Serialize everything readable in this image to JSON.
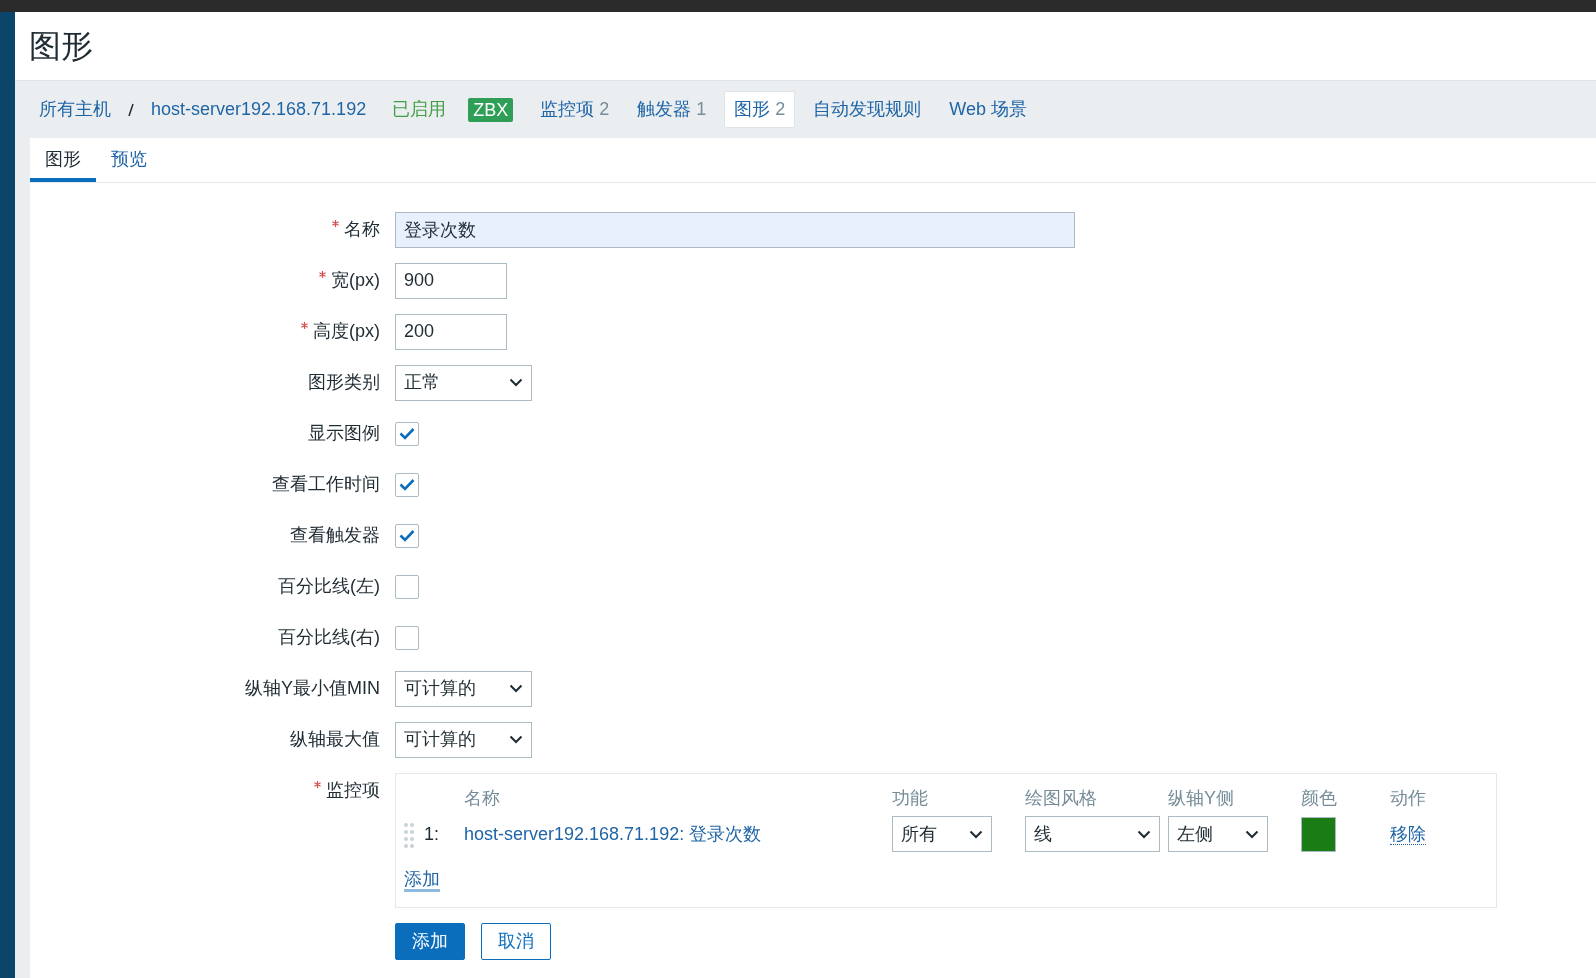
{
  "title": "图形",
  "breadcrumb": [
    {
      "text": "所有主机"
    },
    {
      "text": "host-server192.168.71.192"
    }
  ],
  "host_status": "已启用",
  "badge": "ZBX",
  "host_tabs": [
    {
      "label": "监控项",
      "count": "2",
      "selected": false
    },
    {
      "label": "触发器",
      "count": "1",
      "selected": false
    },
    {
      "label": "图形",
      "count": "2",
      "selected": true
    },
    {
      "label": "自动发现规则",
      "selected": false
    },
    {
      "label": "Web 场景",
      "selected": false
    }
  ],
  "tabs": [
    {
      "label": "图形",
      "selected": true
    },
    {
      "label": "预览",
      "selected": false
    }
  ],
  "fields": [
    {
      "kind": "text",
      "label": "名称",
      "required": true,
      "value": "登录次数",
      "wide": true,
      "focused": true
    },
    {
      "kind": "text",
      "label": "宽(px)",
      "required": true,
      "value": "900"
    },
    {
      "kind": "text",
      "label": "高度(px)",
      "required": true,
      "value": "200"
    },
    {
      "kind": "select",
      "label": "图形类别",
      "value": "正常"
    },
    {
      "kind": "checkbox",
      "label": "显示图例",
      "checked": true
    },
    {
      "kind": "checkbox",
      "label": "查看工作时间",
      "checked": true
    },
    {
      "kind": "checkbox",
      "label": "查看触发器",
      "checked": true
    },
    {
      "kind": "checkbox",
      "label": "百分比线(左)",
      "checked": false
    },
    {
      "kind": "checkbox",
      "label": "百分比线(右)",
      "checked": false
    },
    {
      "kind": "select",
      "label": "纵轴Y最小值MIN",
      "value": "可计算的"
    },
    {
      "kind": "select",
      "label": "纵轴最大值",
      "value": "可计算的"
    }
  ],
  "items": {
    "label": "监控项",
    "required": true,
    "columns": [
      "名称",
      "功能",
      "绘图风格",
      "纵轴Y侧",
      "颜色",
      "动作"
    ],
    "rows": [
      {
        "index": "1:",
        "name": "host-server192.168.71.192: 登录次数",
        "function": "所有",
        "draw_style": "线",
        "y_side": "左侧",
        "color": "#1a7c14",
        "action": "移除"
      }
    ],
    "add_link": "添加"
  },
  "buttons": [
    {
      "label": "添加",
      "kind": "primary"
    },
    {
      "label": "取消",
      "kind": "secondary"
    }
  ]
}
